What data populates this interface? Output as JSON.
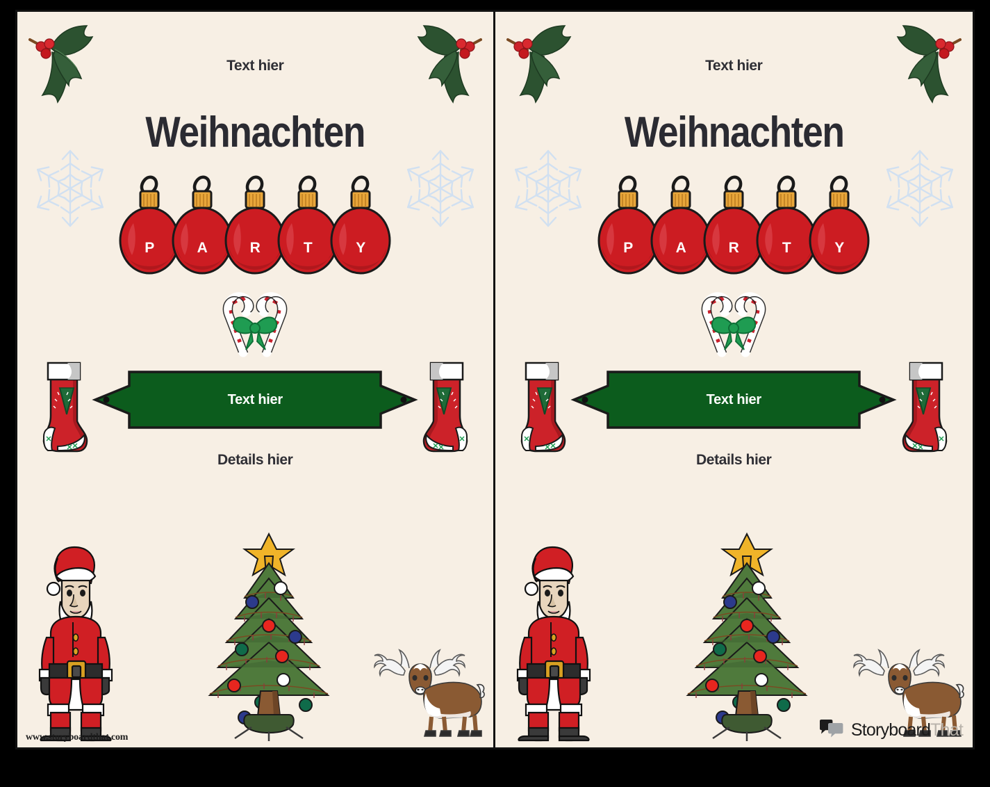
{
  "document": {
    "type": "christmas-party-invitation-template",
    "language": "de",
    "panel_count": 2,
    "background_color": "#f7efe4",
    "border_color": "#111111"
  },
  "panel": {
    "top_text": "Text hier",
    "title": "Weihnachten",
    "banner_text": "Text hier",
    "details_text": "Details hier",
    "banner_color": "#0c5c1d",
    "banner_text_color": "#ffffff",
    "title_color": "#2b2b32"
  },
  "baubles": {
    "letters": [
      "P",
      "A",
      "R",
      "T",
      "Y"
    ],
    "ball_color": "#cc1c22",
    "cap_color": "#e8a63a",
    "letter_color": "#ffffff"
  },
  "decorations": {
    "holly_leaf_color": "#2c5230",
    "holly_berry_color": "#cc2229",
    "snowflake_color": "#cfe0f2",
    "candy_cane_stripe": "#c8202c",
    "candy_cane_bow": "#1f9c52",
    "stocking_body": "#cc2229",
    "stocking_cuff": "#ffffff",
    "stocking_patch": "#1f6b38",
    "tree_foliage": "#4f7a3c",
    "tree_star": "#f0b429",
    "tree_trunk": "#8a5a33",
    "santa_suit": "#d01f24",
    "santa_trim": "#ffffff",
    "santa_belt": "#2c2c2c",
    "santa_buckle": "#d8a022",
    "reindeer_body": "#8a5a33",
    "reindeer_antler": "#f2f2f2"
  },
  "footer": {
    "watermark": "www.storyboardthat.com",
    "logo_primary": "Storyboard",
    "logo_secondary": "That"
  }
}
